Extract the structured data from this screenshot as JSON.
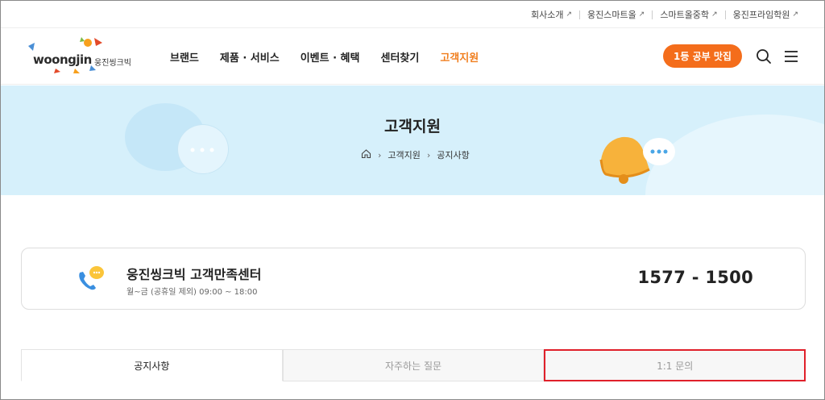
{
  "util_links": [
    "회사소개",
    "웅진스마트올",
    "스마트올중학",
    "웅진프라임학원"
  ],
  "logo": {
    "word": "woongjin",
    "sub": "웅진씽크빅"
  },
  "nav": [
    {
      "label": "브랜드"
    },
    {
      "label": "제품 · 서비스"
    },
    {
      "label": "이벤트 · 혜택"
    },
    {
      "label": "센터찾기"
    },
    {
      "label": "고객지원",
      "active": true
    }
  ],
  "cta_label": "1등 공부 맛집",
  "banner": {
    "title": "고객지원",
    "crumbs": [
      "고객지원",
      "공지사항"
    ]
  },
  "contact": {
    "title": "웅진씽크빅 고객만족센터",
    "hours": "월~금 (공휴일 제외) 09:00 ~ 18:00",
    "phone": "1577 - 1500"
  },
  "tabs": [
    {
      "label": "공지사항",
      "active": true
    },
    {
      "label": "자주하는 질문"
    },
    {
      "label": "1:1 문의",
      "highlighted": true
    }
  ],
  "colors": {
    "accent": "#f07e1e",
    "cta": "#f46d1b",
    "banner_bg": "#d6f0fb",
    "highlight_box": "#e0202a"
  },
  "icons": [
    "external-link-icon",
    "search-icon",
    "menu-icon",
    "home-icon",
    "chevron-right-icon",
    "phone-chat-icon",
    "bell-icon",
    "speech-bubble-icon"
  ]
}
